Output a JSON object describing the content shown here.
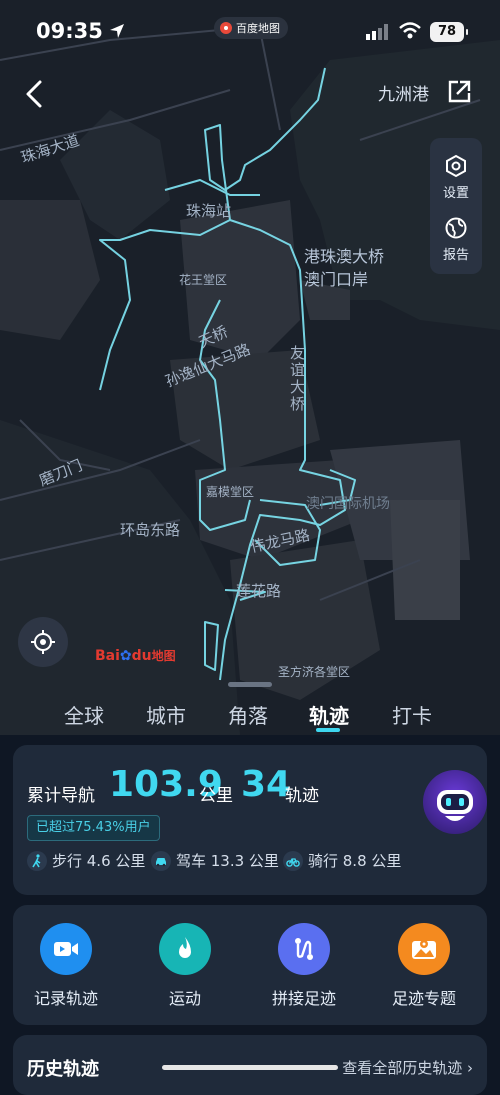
{
  "status_bar": {
    "time": "09:35",
    "battery": "78"
  },
  "app_pill": {
    "label": "百度地图"
  },
  "header": {
    "location_label": "九洲港"
  },
  "side_panel": {
    "settings_label": "设置",
    "report_label": "报告"
  },
  "map_labels": {
    "zhuhai_avenue": "珠海大道",
    "zhuhai_station": "珠海站",
    "hongkong_bridge": "港珠澳大桥",
    "macau_port": "澳门口岸",
    "huawang": "花王堂区",
    "tianqiao": "天桥",
    "sunyixian": "孙逸仙大马路",
    "youyi_bridge": "友谊大桥",
    "modaomen": "磨刀门",
    "jiamo": "嘉模堂区",
    "airport": "澳门国际机场",
    "huandao": "环岛东路",
    "weilong": "伟龙马路",
    "lianhua": "莲花路",
    "shengfangji": "圣方济各堂区"
  },
  "tabs": [
    {
      "label": "全球"
    },
    {
      "label": "城市"
    },
    {
      "label": "角落"
    },
    {
      "label": "轨迹",
      "active": true
    },
    {
      "label": "打卡"
    }
  ],
  "stats": {
    "title": "累计导航",
    "distance": "103.9",
    "distance_unit": "公里",
    "tracks": "34",
    "tracks_unit": "轨迹",
    "exceed_text": "已超过75.43%用户",
    "walk": "步行 4.6 公里",
    "drive": "驾车 13.3 公里",
    "ride": "骑行 8.8 公里"
  },
  "actions": [
    {
      "label": "记录轨迹",
      "color": "#1f8ff0"
    },
    {
      "label": "运动",
      "color": "#17b5b5"
    },
    {
      "label": "拼接足迹",
      "color": "#5a6ff0"
    },
    {
      "label": "足迹专题",
      "color": "#f48a1f"
    }
  ],
  "history": {
    "title": "历史轨迹",
    "link": "查看全部历史轨迹 ›"
  },
  "colors": {
    "accent": "#40d8f0",
    "track": "#7fe6f5"
  }
}
